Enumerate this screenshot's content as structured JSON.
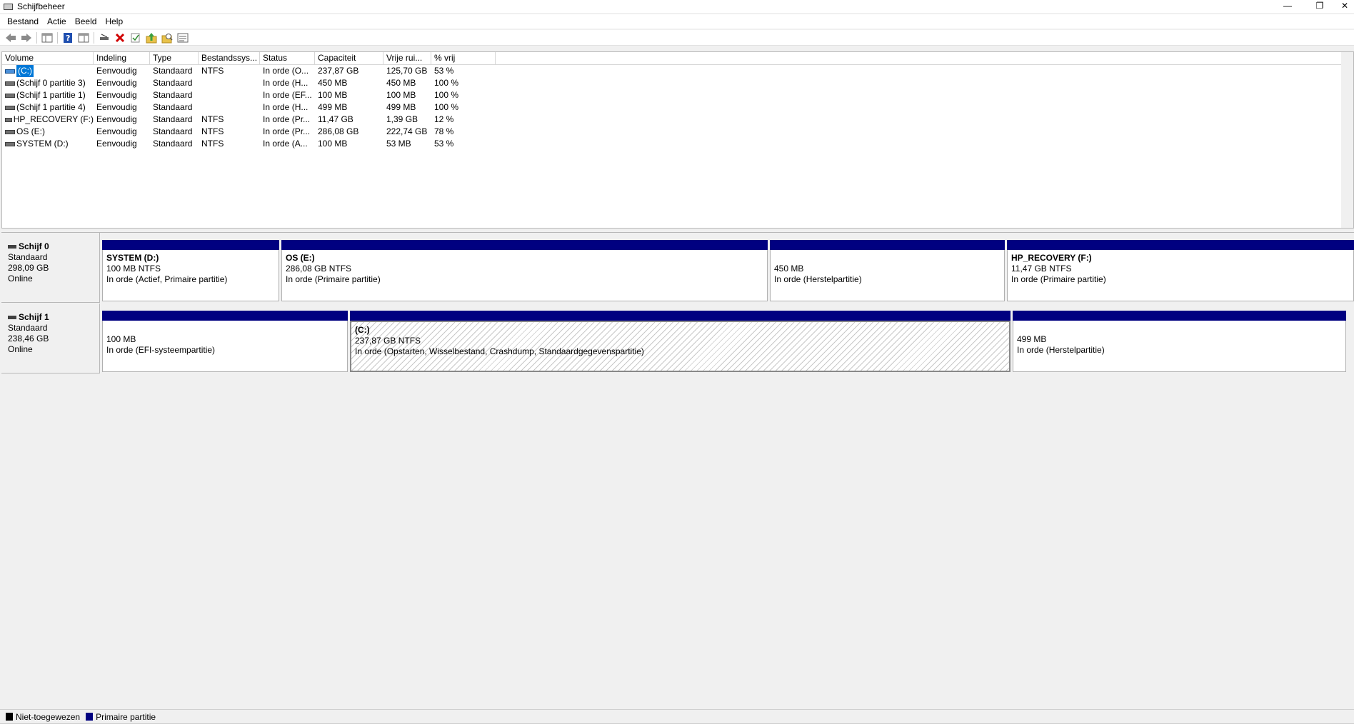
{
  "window": {
    "title": "Schijfbeheer",
    "minimize_glyph": "—",
    "restore_glyph": "❐",
    "close_glyph": "✕"
  },
  "menubar": {
    "items": [
      "Bestand",
      "Actie",
      "Beeld",
      "Help"
    ]
  },
  "toolbar": {
    "icons": [
      "back-arrow-icon",
      "forward-arrow-icon",
      "console-tree-icon",
      "help-icon",
      "properties-view-icon",
      "connect-icon",
      "delete-icon",
      "check-icon",
      "folder-up-icon",
      "search-folder-icon",
      "list-view-icon"
    ]
  },
  "volumes": {
    "columns": [
      "Volume",
      "Indeling",
      "Type",
      "Bestandssys...",
      "Status",
      "Capaciteit",
      "Vrije rui...",
      "% vrij"
    ],
    "rows": [
      {
        "volume": "(C:)",
        "indeling": "Eenvoudig",
        "type": "Standaard",
        "fs": "NTFS",
        "status": "In orde (O...",
        "capaciteit": "237,87 GB",
        "vrij": "125,70 GB",
        "pct": "53 %"
      },
      {
        "volume": "(Schijf 0 partitie 3)",
        "indeling": "Eenvoudig",
        "type": "Standaard",
        "fs": "",
        "status": "In orde (H...",
        "capaciteit": "450 MB",
        "vrij": "450 MB",
        "pct": "100 %"
      },
      {
        "volume": "(Schijf 1 partitie 1)",
        "indeling": "Eenvoudig",
        "type": "Standaard",
        "fs": "",
        "status": "In orde (EF...",
        "capaciteit": "100 MB",
        "vrij": "100 MB",
        "pct": "100 %"
      },
      {
        "volume": "(Schijf 1 partitie 4)",
        "indeling": "Eenvoudig",
        "type": "Standaard",
        "fs": "",
        "status": "In orde (H...",
        "capaciteit": "499 MB",
        "vrij": "499 MB",
        "pct": "100 %"
      },
      {
        "volume": "HP_RECOVERY (F:)",
        "indeling": "Eenvoudig",
        "type": "Standaard",
        "fs": "NTFS",
        "status": "In orde (Pr...",
        "capaciteit": "11,47 GB",
        "vrij": "1,39 GB",
        "pct": "12 %"
      },
      {
        "volume": "OS (E:)",
        "indeling": "Eenvoudig",
        "type": "Standaard",
        "fs": "NTFS",
        "status": "In orde (Pr...",
        "capaciteit": "286,08 GB",
        "vrij": "222,74 GB",
        "pct": "78 %"
      },
      {
        "volume": "SYSTEM (D:)",
        "indeling": "Eenvoudig",
        "type": "Standaard",
        "fs": "NTFS",
        "status": "In orde (A...",
        "capaciteit": "100 MB",
        "vrij": "53 MB",
        "pct": "53 %"
      }
    ]
  },
  "disks": [
    {
      "name": "Schijf 0",
      "type": "Standaard",
      "size": "298,09 GB",
      "state": "Online",
      "partitions": [
        {
          "name": "SYSTEM  (D:)",
          "size": "100 MB NTFS",
          "status": "In orde (Actief, Primaire partitie)"
        },
        {
          "name": "OS  (E:)",
          "size": "286,08 GB NTFS",
          "status": "In orde (Primaire partitie)"
        },
        {
          "name": "",
          "size": "450 MB",
          "status": "In orde (Herstelpartitie)"
        },
        {
          "name": "HP_RECOVERY  (F:)",
          "size": "11,47 GB NTFS",
          "status": "In orde (Primaire partitie)"
        }
      ]
    },
    {
      "name": "Schijf 1",
      "type": "Standaard",
      "size": "238,46 GB",
      "state": "Online",
      "partitions": [
        {
          "name": "",
          "size": "100 MB",
          "status": "In orde (EFI-systeempartitie)"
        },
        {
          "name": "(C:)",
          "size": "237,87 GB NTFS",
          "status": "In orde (Opstarten, Wisselbestand, Crashdump, Standaardgegevenspartitie)"
        },
        {
          "name": "",
          "size": "499 MB",
          "status": "In orde (Herstelpartitie)"
        }
      ]
    }
  ],
  "legend": {
    "items": [
      {
        "label": "Niet-toegewezen",
        "color": "#000000"
      },
      {
        "label": "Primaire partitie",
        "color": "#000080"
      }
    ]
  }
}
